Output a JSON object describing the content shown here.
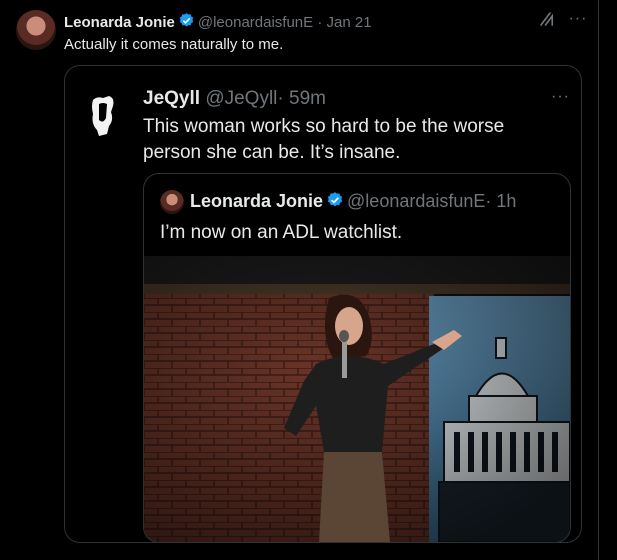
{
  "tweet": {
    "author_name": "Leonarda Jonie",
    "handle": "@leonardaisfunE",
    "time": "· Jan 21",
    "text": "Actually it comes naturally to me.",
    "icons": [
      "verified-badge-icon",
      "grok-icon",
      "more-icon"
    ]
  },
  "quoted_tweet": {
    "author_name": "JeQyll",
    "handle": "@JeQyll",
    "time": "· 59m",
    "text": "This woman works so hard to be the worse person she can be. It’s insane."
  },
  "nested_quote": {
    "author_name": "Leonarda Jonie",
    "handle": "@leonardaisfunE",
    "time": "· 1h",
    "text": "I’m now on an ADL watchlist."
  },
  "colors": {
    "background": "#000000",
    "text": "#e7e9ea",
    "muted": "#71767b",
    "border": "#2f3336",
    "verified": "#1d9bf0"
  }
}
